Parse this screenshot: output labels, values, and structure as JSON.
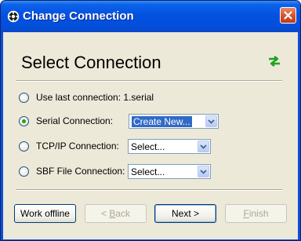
{
  "window": {
    "title": "Change Connection"
  },
  "page": {
    "heading": "Select Connection"
  },
  "options": [
    {
      "label": "Use last connection: 1.serial",
      "checked": false
    },
    {
      "label": "Serial Connection:",
      "checked": true,
      "select_value": "Create New..."
    },
    {
      "label": "TCP/IP Connection:",
      "checked": false,
      "select_value": "Select..."
    },
    {
      "label": "SBF File Connection:",
      "checked": false,
      "select_value": "Select..."
    }
  ],
  "buttons": {
    "work_offline": "Work offline",
    "back_prefix": "< ",
    "back_mnemonic": "B",
    "back_rest": "ack",
    "next": "Next >",
    "finish_mnemonic": "F",
    "finish_rest": "inish"
  },
  "icons": {
    "app": "app-cog-icon",
    "nav": "green-arrows-icon",
    "close": "close-icon",
    "dropdown": "chevron-down-icon"
  },
  "colors": {
    "titlebar": "#0551e0",
    "client": "#ece9d8",
    "selected_text_bg": "#316ac5",
    "radio_dot": "#21a121",
    "nav_icon": "#1fa31f"
  }
}
